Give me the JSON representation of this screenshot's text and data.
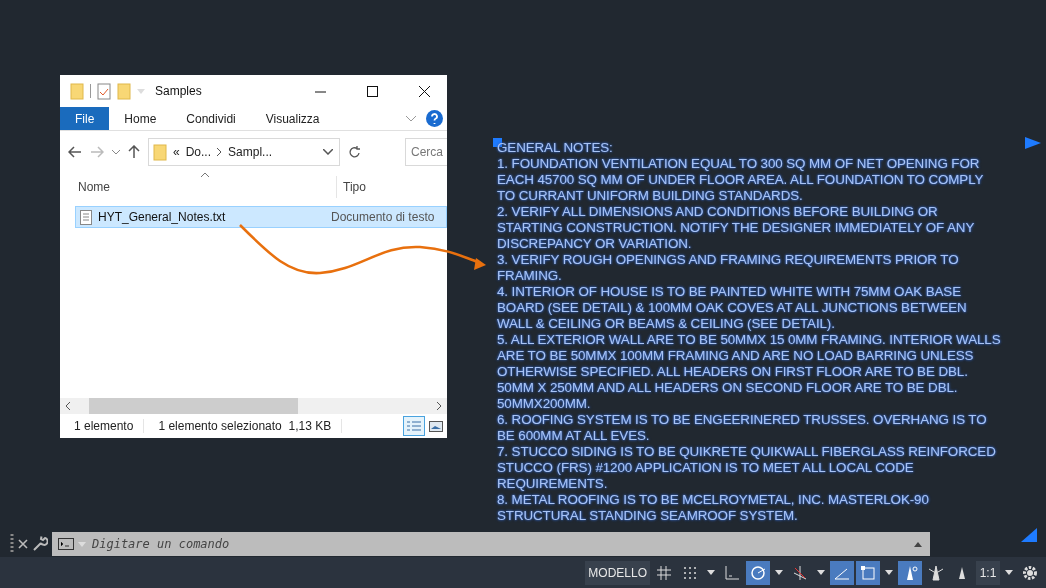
{
  "explorer": {
    "title": "Samples",
    "ribbon_tabs": [
      {
        "label": "File",
        "selected": true
      },
      {
        "label": "Home",
        "selected": false
      },
      {
        "label": "Condividi",
        "selected": false
      },
      {
        "label": "Visualizza",
        "selected": false
      }
    ],
    "address": {
      "overflow": "«",
      "crumbs": [
        "Do...",
        "Sampl..."
      ]
    },
    "search": {
      "placeholder": "Cerca"
    },
    "columns": [
      "Nome",
      "Tipo"
    ],
    "files": [
      {
        "name": "HYT_General_Notes.txt",
        "type": "Documento di testo",
        "selected": true
      }
    ],
    "status": [
      "1 elemento",
      "1 elemento selezionato  1,13 KB"
    ],
    "view": [
      {
        "kind": "details",
        "selected": true
      },
      {
        "kind": "tiles",
        "selected": false
      }
    ]
  },
  "notes": {
    "title": "GENERAL NOTES:",
    "items": [
      {
        "lines": [
          "1. FOUNDATION VENTILATION EQUAL TO 300 SQ MM OF NET OPENING FOR",
          "EACH 45700 SQ MM OF UNDER FLOOR AREA. ALL FOUNDATION TO COMPLY",
          "TO CURRANT UNIFORM BUILDING STANDARDS."
        ]
      },
      {
        "lines": [
          "2. VERIFY ALL DIMENSIONS AND CONDITIONS BEFORE BUILDING OR",
          "STARTING CONSTRUCTION. NOTIFY THE DESIGNER IMMEDIATELY OF ANY",
          "DISCREPANCY OR VARIATION."
        ]
      },
      {
        "lines": [
          "3. VERIFY ROUGH OPENINGS AND FRAMING REQUIREMENTS PRIOR TO",
          "FRAMING."
        ]
      },
      {
        "lines": [
          "4. INTERIOR OF HOUSE IS TO BE PAINTED WHITE WITH 75MM OAK BASE",
          "BOARD (SEE DETAIL) & 100MM OAK COVES AT ALL JUNCTIONS BETWEEN",
          "WALL & CEILING OR BEAMS & CEILING (SEE DETAIL)."
        ]
      },
      {
        "lines": [
          "5. ALL EXTERIOR WALL ARE TO BE 50MMX 15 0MM FRAMING. INTERIOR WALLS",
          "ARE TO BE 50MMX 100MM FRAMING AND ARE NO LOAD BARRING UNLESS",
          "OTHERWISE SPECIFIED. ALL HEADERS ON FIRST FLOOR ARE TO BE DBL.",
          "50MM X 250MM AND ALL HEADERS ON SECOND FLOOR ARE TO BE DBL.",
          "50MMX200MM."
        ]
      },
      {
        "lines": [
          "6. ROOFING SYSTEM IS TO BE ENGEERINERED TRUSSES. OVERHANG IS TO",
          "BE 600MM AT ALL EVES."
        ]
      },
      {
        "lines": [
          "7. STUCCO SIDING IS TO BE QUIKRETE QUIKWALL FIBERGLASS REINFORCED",
          "STUCCO (FRS) #1200 APPLICATION IS TO MEET ALL LOCAL CODE",
          "REQUIREMENTS."
        ]
      },
      {
        "lines": [
          "8. METAL ROOFING IS TO BE MCELROYMETAL, INC. MASTERLOK-90",
          "STRUCTURAL STANDING SEAMROOF SYSTEM."
        ]
      }
    ]
  },
  "command": {
    "placeholder": "Digitare un comando"
  },
  "statusbar": [
    {
      "kind": "text",
      "label": "MODELLO",
      "on": false
    },
    {
      "kind": "grid",
      "on": false
    },
    {
      "kind": "dots",
      "on": false
    },
    {
      "kind": "caret",
      "on": false
    },
    {
      "kind": "ortho",
      "on": false
    },
    {
      "kind": "polar",
      "on": true
    },
    {
      "kind": "caret",
      "on": false
    },
    {
      "kind": "snap",
      "on": false
    },
    {
      "kind": "caret",
      "on": false
    },
    {
      "kind": "angle",
      "on": true
    },
    {
      "kind": "frame",
      "on": true
    },
    {
      "kind": "caret",
      "on": false
    },
    {
      "kind": "annot",
      "on": true
    },
    {
      "kind": "annot2",
      "on": false
    },
    {
      "kind": "annot3",
      "on": false
    },
    {
      "kind": "text",
      "label": "1:1",
      "on": false
    },
    {
      "kind": "caret",
      "on": false
    },
    {
      "kind": "gear",
      "on": false
    }
  ]
}
